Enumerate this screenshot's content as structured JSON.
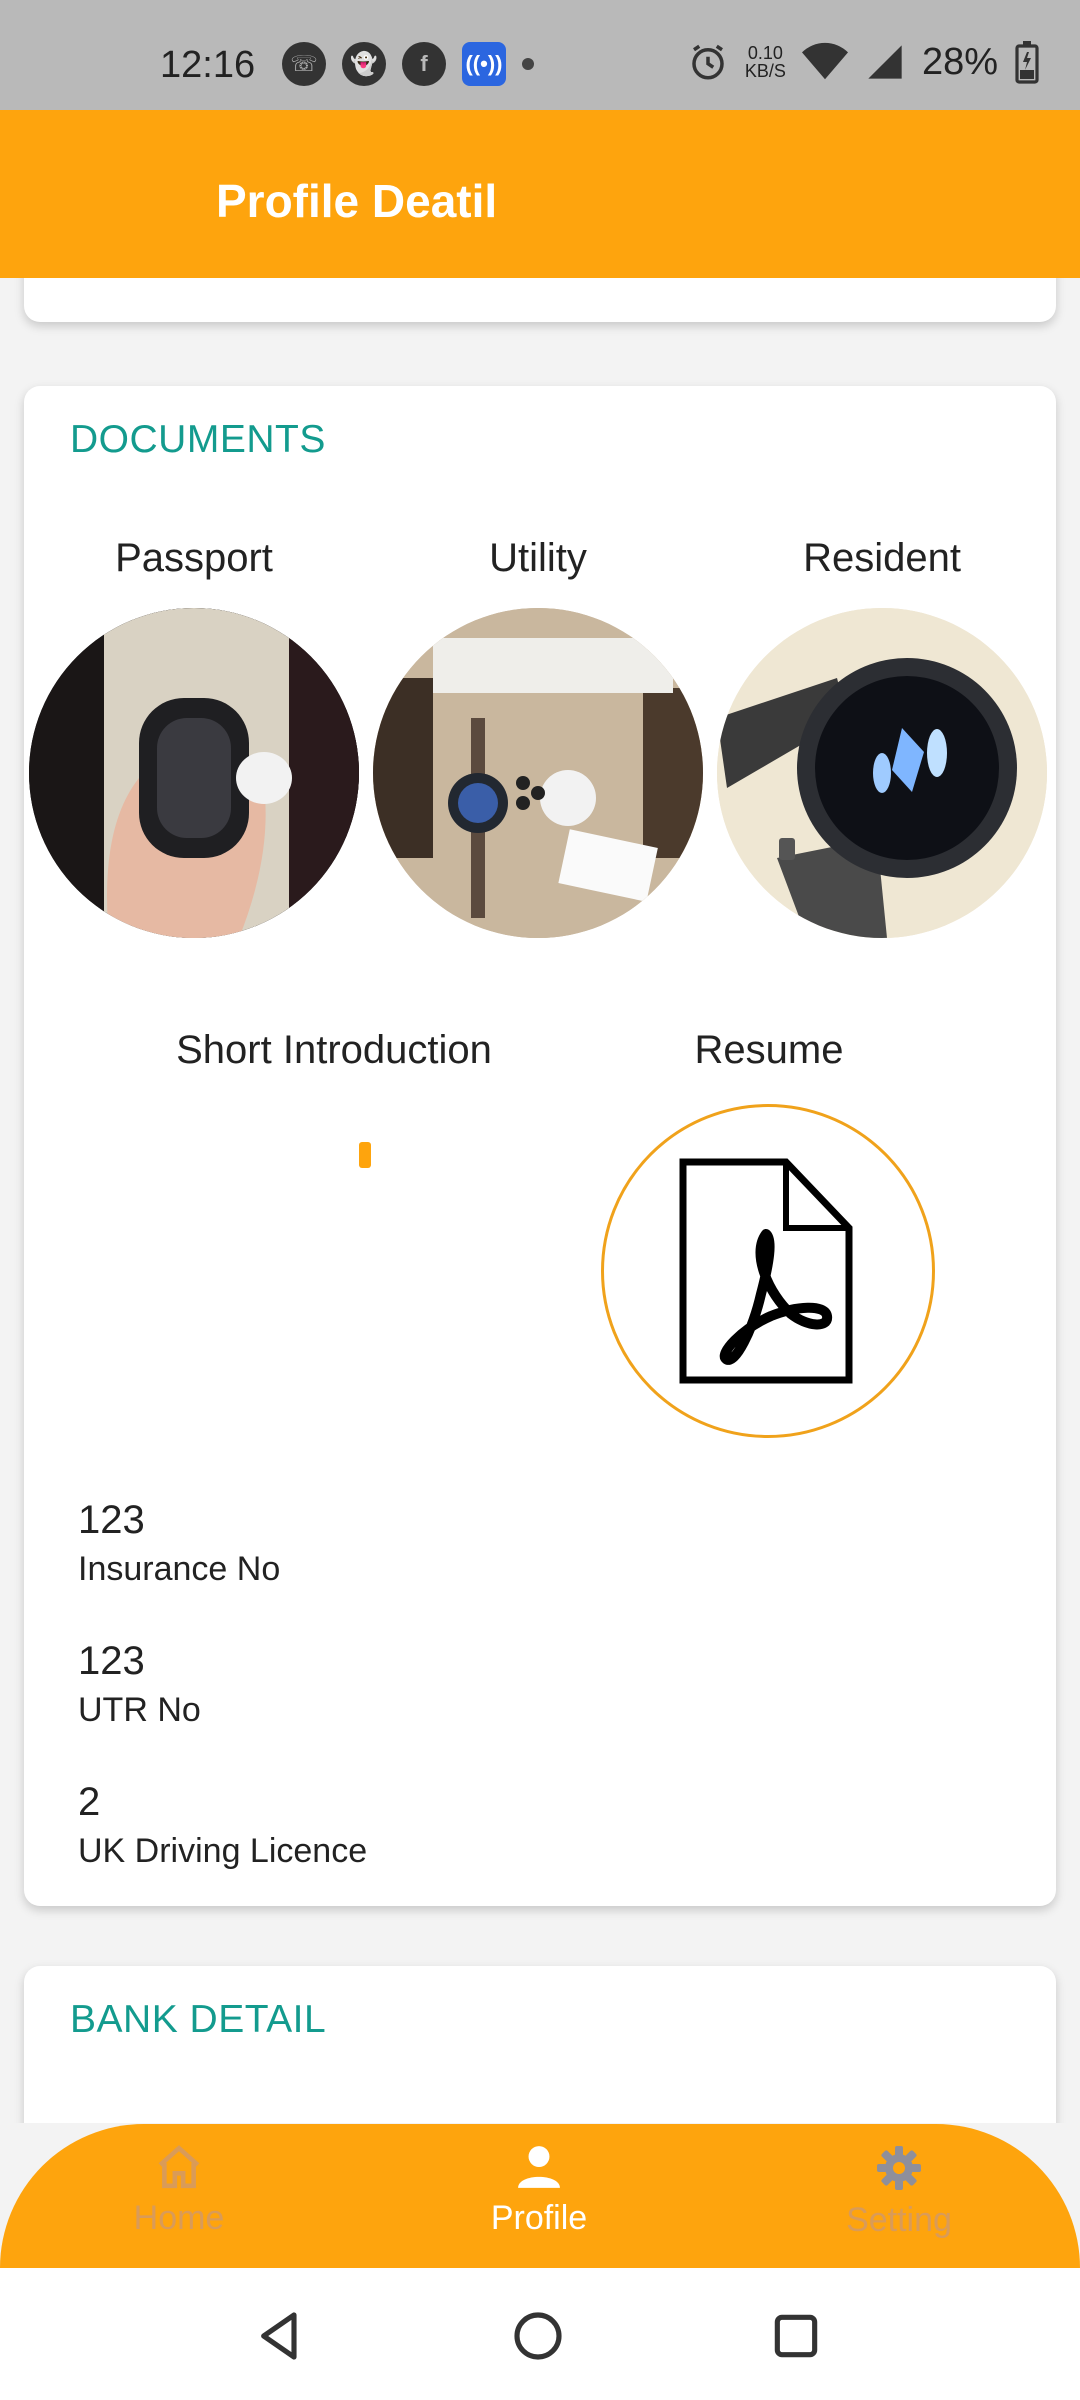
{
  "status_bar": {
    "time": "12:16",
    "net_speed_value": "0.10",
    "net_speed_unit": "KB/S",
    "battery": "28%"
  },
  "app_bar": {
    "title": "Profile Deatil"
  },
  "documents": {
    "title": "DOCUMENTS",
    "items": [
      {
        "label": "Passport"
      },
      {
        "label": "Utility"
      },
      {
        "label": "Resident"
      }
    ],
    "short_intro_label": "Short Introduction",
    "resume_label": "Resume",
    "fields": [
      {
        "value": "123",
        "label": "Insurance No"
      },
      {
        "value": "123",
        "label": "UTR No"
      },
      {
        "value": "2",
        "label": "UK Driving Licence"
      }
    ]
  },
  "bank": {
    "title": "BANK DETAIL"
  },
  "bottom_nav": {
    "items": [
      {
        "label": "Home",
        "icon": "home-icon",
        "active": false
      },
      {
        "label": "Profile",
        "icon": "person-icon",
        "active": true
      },
      {
        "label": "Setting",
        "icon": "gear-icon",
        "active": false
      }
    ]
  },
  "colors": {
    "accent": "#fea40d",
    "section_title": "#139b8e",
    "status_bar": "#b9b9b9",
    "resume_ring": "#f0a21b"
  }
}
